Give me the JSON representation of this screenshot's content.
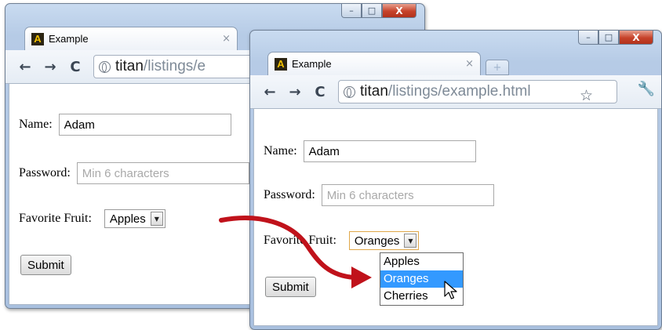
{
  "browser": {
    "tab_title": "Example",
    "tab_close": "×",
    "new_tab": "+",
    "url_host": "titan",
    "url_path_full": "/listings/example.html",
    "url_path_truncated": "/listings/e",
    "minimize": "–",
    "maximize": "□",
    "close": "X",
    "favicon_letter": "A"
  },
  "form": {
    "name_label": "Name:",
    "name_value": "Adam",
    "password_label": "Password:",
    "password_placeholder": "Min 6 characters",
    "fruit_label": "Favorite Fruit:",
    "submit_label": "Submit"
  },
  "before": {
    "fruit_selected": "Apples"
  },
  "after": {
    "fruit_selected": "Oranges",
    "options": [
      "Apples",
      "Oranges",
      "Cherries"
    ],
    "highlighted_option": "Oranges"
  },
  "colors": {
    "arrow": "#c0121b",
    "highlight": "#3399ff",
    "close_button": "#c6422a"
  },
  "icons": [
    "back-arrow-icon",
    "forward-arrow-icon",
    "reload-icon",
    "globe-icon",
    "star-icon",
    "wrench-icon",
    "dropdown-arrow-icon",
    "mouse-pointer-icon"
  ]
}
